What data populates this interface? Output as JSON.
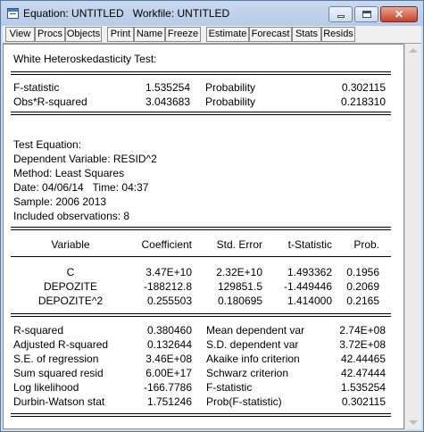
{
  "window": {
    "title": "Equation: UNTITLED   Workfile: UNTITLED"
  },
  "toolbar": [
    "View",
    "Procs",
    "Objects",
    "Print",
    "Name",
    "Freeze",
    "Estimate",
    "Forecast",
    "Stats",
    "Resids"
  ],
  "output": {
    "test_title": "White Heteroskedasticity Test:",
    "summary": [
      {
        "label": "F-statistic",
        "value": "1.535254",
        "prob_label": "Probability",
        "prob": "0.302115"
      },
      {
        "label": "Obs*R-squared",
        "value": "3.043683",
        "prob_label": "Probability",
        "prob": "0.218310"
      }
    ],
    "info": [
      "Test Equation:",
      "Dependent Variable: RESID^2",
      "Method: Least Squares",
      "Date: 04/06/14   Time: 04:37",
      "Sample: 2006 2013",
      "Included observations: 8"
    ],
    "coef_headers": [
      "Variable",
      "Coefficient",
      "Std. Error",
      "t-Statistic",
      "Prob."
    ],
    "coef_rows": [
      [
        "C",
        "3.47E+10",
        "2.32E+10",
        "1.493362",
        "0.1956"
      ],
      [
        "DEPOZITE",
        "-188212.8",
        "129851.5",
        "-1.449446",
        "0.2069"
      ],
      [
        "DEPOZITE^2",
        "0.255503",
        "0.180695",
        "1.414000",
        "0.2165"
      ]
    ],
    "stats_rows": [
      [
        "R-squared",
        "0.380460",
        "Mean dependent var",
        "2.74E+08"
      ],
      [
        "Adjusted R-squared",
        "0.132644",
        "S.D. dependent var",
        "3.72E+08"
      ],
      [
        "S.E. of regression",
        "3.46E+08",
        "Akaike info criterion",
        "42.44465"
      ],
      [
        "Sum squared resid",
        "6.00E+17",
        "Schwarz criterion",
        "42.47444"
      ],
      [
        "Log likelihood",
        "-166.7786",
        "F-statistic",
        "1.535254"
      ],
      [
        "Durbin-Watson stat",
        "1.751246",
        "Prob(F-statistic)",
        "0.302115"
      ]
    ]
  }
}
